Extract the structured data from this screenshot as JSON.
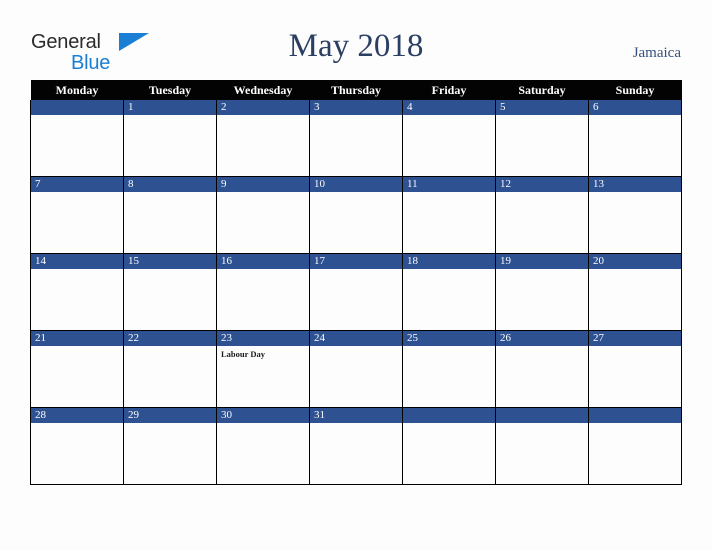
{
  "brand": {
    "name_part1": "General",
    "name_part2": "Blue",
    "triangle_icon": "triangle-icon",
    "accent_color": "#1a7fd4",
    "text_color": "#2b2b2b"
  },
  "header": {
    "title": "May 2018",
    "country": "Jamaica",
    "title_color": "#2b3f63",
    "country_color": "#35507d"
  },
  "calendar": {
    "weekday_headers": [
      "Monday",
      "Tuesday",
      "Wednesday",
      "Thursday",
      "Friday",
      "Saturday",
      "Sunday"
    ],
    "header_bg": "#030303",
    "header_fg": "#ffffff",
    "daybar_bg": "#2d5191",
    "daybar_fg": "#ffffff",
    "cell_bg": "#fdfdfd",
    "border_color": "#000000",
    "weeks": [
      [
        {
          "date": "",
          "event": ""
        },
        {
          "date": "1",
          "event": ""
        },
        {
          "date": "2",
          "event": ""
        },
        {
          "date": "3",
          "event": ""
        },
        {
          "date": "4",
          "event": ""
        },
        {
          "date": "5",
          "event": ""
        },
        {
          "date": "6",
          "event": ""
        }
      ],
      [
        {
          "date": "7",
          "event": ""
        },
        {
          "date": "8",
          "event": ""
        },
        {
          "date": "9",
          "event": ""
        },
        {
          "date": "10",
          "event": ""
        },
        {
          "date": "11",
          "event": ""
        },
        {
          "date": "12",
          "event": ""
        },
        {
          "date": "13",
          "event": ""
        }
      ],
      [
        {
          "date": "14",
          "event": ""
        },
        {
          "date": "15",
          "event": ""
        },
        {
          "date": "16",
          "event": ""
        },
        {
          "date": "17",
          "event": ""
        },
        {
          "date": "18",
          "event": ""
        },
        {
          "date": "19",
          "event": ""
        },
        {
          "date": "20",
          "event": ""
        }
      ],
      [
        {
          "date": "21",
          "event": ""
        },
        {
          "date": "22",
          "event": ""
        },
        {
          "date": "23",
          "event": "Labour Day"
        },
        {
          "date": "24",
          "event": ""
        },
        {
          "date": "25",
          "event": ""
        },
        {
          "date": "26",
          "event": ""
        },
        {
          "date": "27",
          "event": ""
        }
      ],
      [
        {
          "date": "28",
          "event": ""
        },
        {
          "date": "29",
          "event": ""
        },
        {
          "date": "30",
          "event": ""
        },
        {
          "date": "31",
          "event": ""
        },
        {
          "date": "",
          "event": ""
        },
        {
          "date": "",
          "event": ""
        },
        {
          "date": "",
          "event": ""
        }
      ]
    ]
  }
}
